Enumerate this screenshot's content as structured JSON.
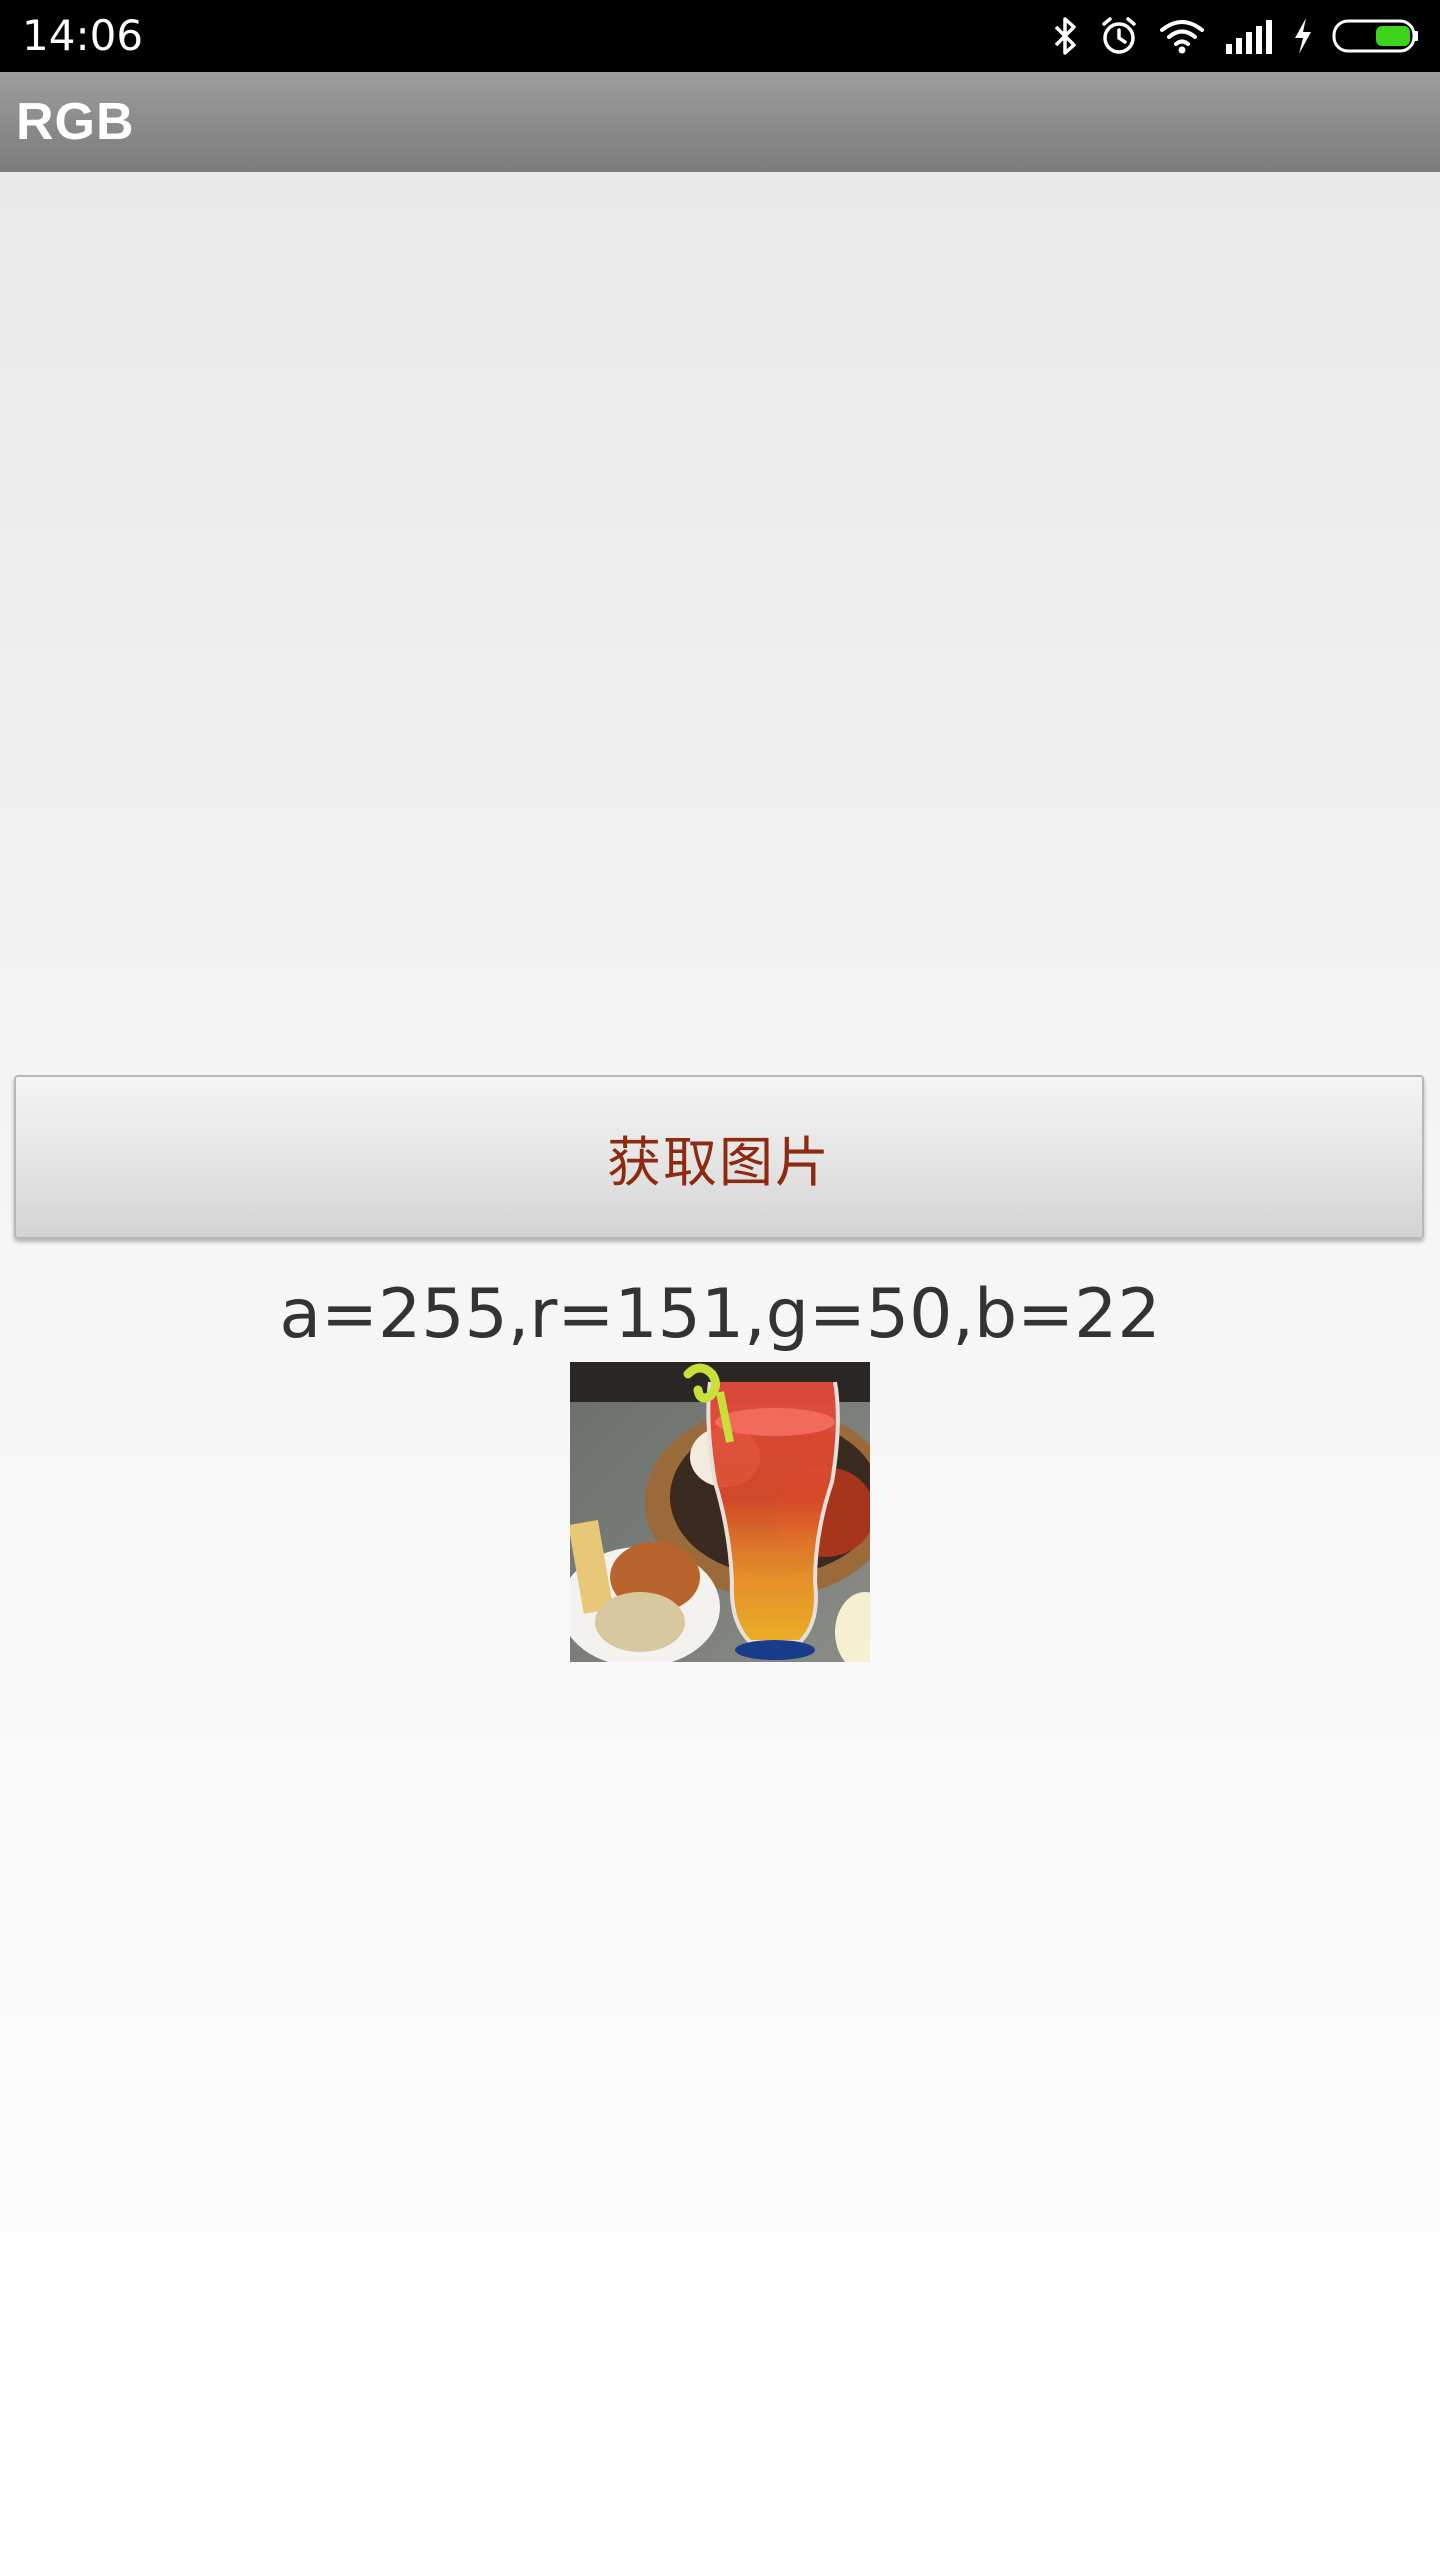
{
  "status_bar": {
    "time": "14:06",
    "icons": [
      "bluetooth-icon",
      "alarm-icon",
      "wifi-icon",
      "signal-icon",
      "charging-icon",
      "battery-icon"
    ],
    "battery_color": "#3dd21b"
  },
  "action_bar": {
    "title": "RGB"
  },
  "main": {
    "button_label": "获取图片",
    "button_text_color": "#8e2a10",
    "rgb_text": "a=255,r=151,g=50,b=22",
    "image_alt": "food-and-drink-photo"
  }
}
